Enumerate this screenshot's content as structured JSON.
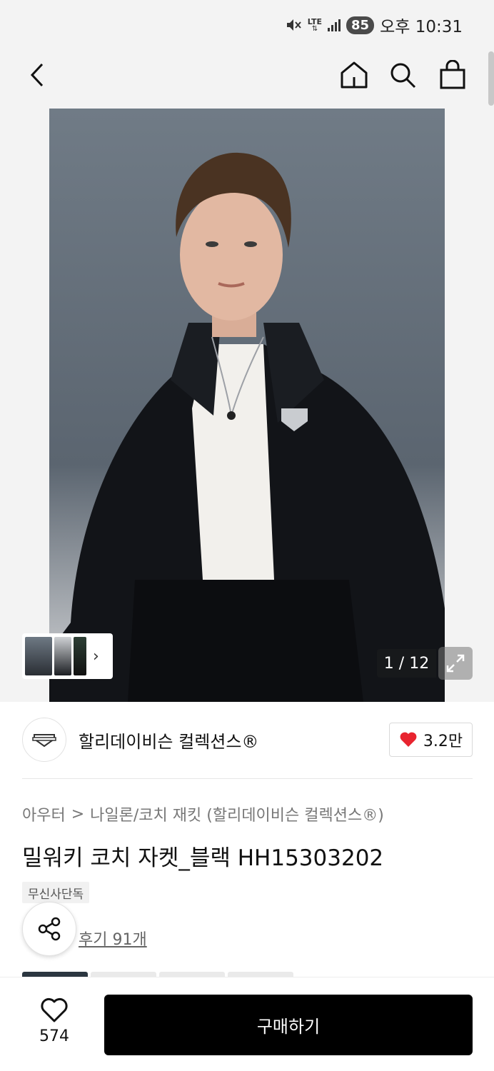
{
  "status_bar": {
    "network": "LTE",
    "battery": "85",
    "time": "오후 10:31"
  },
  "nav": {
    "back_icon": "chevron-left-icon",
    "home_icon": "home-icon",
    "search_icon": "search-icon",
    "cart_icon": "shopping-bag-icon"
  },
  "gallery": {
    "counter": "1 / 12",
    "thumb_more": "›",
    "expand_icon": "expand-icon"
  },
  "brand": {
    "name": "할리데이비슨 컬렉션스®",
    "likes": "3.2만",
    "heart_color": "#e8242f"
  },
  "breadcrumb": {
    "level1": "아우터",
    "separator": ">",
    "level2": "나일론/코치 재킷 (할리데이비슨 컬렉션스®)"
  },
  "product": {
    "title": "밀워키 코치 자켓_블랙 HH15303202",
    "badge": "무신사단독",
    "reviews": "후기 91개"
  },
  "bottom_bar": {
    "wish_count": "574",
    "buy_label": "구매하기"
  }
}
